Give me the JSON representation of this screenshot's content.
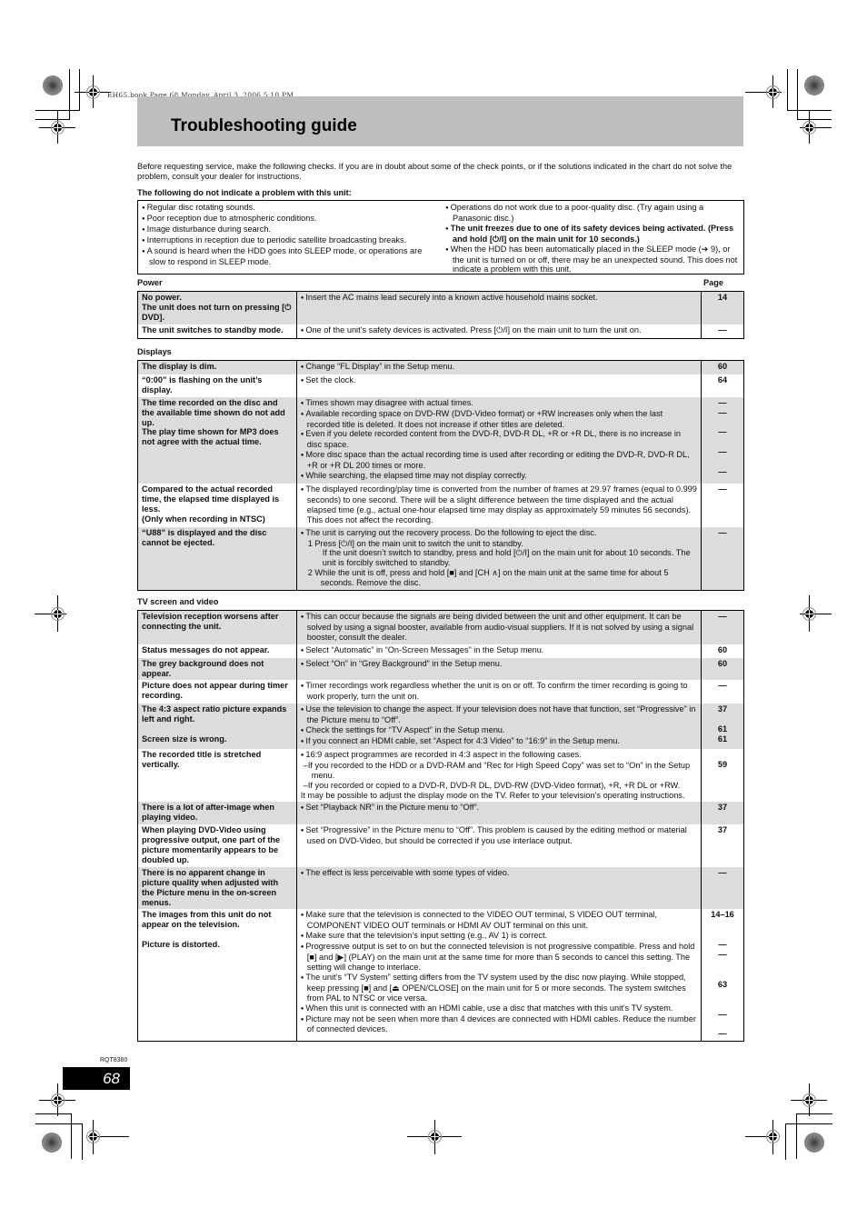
{
  "header": {
    "book_line": "EH65.book  Page 68  Monday, April 3, 2006  5:10 PM",
    "title": "Troubleshooting guide"
  },
  "intro": "Before requesting service, make the following checks. If you are in doubt about some of the check points, or if the solutions indicated in the chart do not solve the problem, consult your dealer for instructions.",
  "no_problem": {
    "heading": "The following do not indicate a problem with this unit:",
    "left": [
      {
        "text": "Regular disc rotating sounds.",
        "bold": false
      },
      {
        "text": "Poor reception due to atmospheric conditions.",
        "bold": false
      },
      {
        "text": "Image disturbance during search.",
        "bold": false
      },
      {
        "text": "Interruptions in reception due to periodic satellite broadcasting breaks.",
        "bold": false
      },
      {
        "text": "A sound is heard when the HDD goes into SLEEP mode, or operations are slow to respond in SLEEP mode.",
        "bold": false
      }
    ],
    "right": [
      {
        "text": "Operations do not work due to a poor-quality disc. (Try again using a Panasonic disc.)",
        "bold": false
      },
      {
        "text": "The unit freezes due to one of its safety devices being activated. (Press and hold [⏻/I] on the main unit for 10 seconds.)",
        "bold": true
      },
      {
        "text": "When the HDD has been automatically placed in the SLEEP mode (➔ 9), or the unit is turned on or off, there may be an unexpected sound. This does not indicate a problem with this unit.",
        "bold": false
      }
    ]
  },
  "page_column_label": "Page",
  "sections": {
    "power": {
      "heading": "Power",
      "rows": [
        {
          "problems": [
            "No power.",
            "The unit does not turn on pressing [⏻ DVD]."
          ],
          "solutions": [
            {
              "t": "b",
              "text": "Insert the AC mains lead securely into a known active household mains socket."
            }
          ],
          "pages": [
            "14"
          ],
          "shade": true
        },
        {
          "problems": [
            "The unit switches to standby mode."
          ],
          "solutions": [
            {
              "t": "b",
              "text": "One of the unit’s safety devices is activated. Press [⏻/I] on the main unit to turn the unit on."
            }
          ],
          "pages": [
            "—"
          ],
          "shade": false
        }
      ]
    },
    "displays": {
      "heading": "Displays",
      "rows": [
        {
          "problems": [
            "The display is dim."
          ],
          "solutions": [
            {
              "t": "b",
              "text": "Change “FL Display” in the Setup menu."
            }
          ],
          "pages": [
            "60"
          ],
          "shade": true
        },
        {
          "problems": [
            "“0:00” is flashing on the unit’s display."
          ],
          "solutions": [
            {
              "t": "b",
              "text": "Set the clock."
            }
          ],
          "pages": [
            "64"
          ],
          "shade": false
        },
        {
          "problems": [
            "The time recorded on the disc and the available time shown do not add up.",
            "The play time shown for MP3 does not agree with the actual time."
          ],
          "solutions": [
            {
              "t": "b",
              "text": "Times shown may disagree with actual times."
            },
            {
              "t": "b",
              "text": "Available recording space on DVD-RW (DVD-Video format) or +RW increases only when the last recorded title is deleted. It does not increase if other titles are deleted."
            },
            {
              "t": "b",
              "text": "Even if you delete recorded content from the DVD-R, DVD-R DL, +R or +R DL, there is no increase in disc space."
            },
            {
              "t": "b",
              "text": "More disc space than the actual recording time is used after recording or editing the DVD-R, DVD-R DL, +R or +R DL 200 times or more."
            },
            {
              "t": "b",
              "text": "While searching, the elapsed time may not display correctly."
            }
          ],
          "pages": [
            "—",
            "—",
            "",
            "—",
            "",
            "—",
            "",
            "—"
          ],
          "shade": true
        },
        {
          "problems": [
            "Compared to the actual recorded time, the elapsed time displayed is less.",
            "(Only when recording in NTSC)"
          ],
          "solutions": [
            {
              "t": "b",
              "text": "The displayed recording/play time is converted from the number of frames at 29.97 frames (equal to 0.999 seconds) to one second. There will be a slight difference between the time displayed and the actual elapsed time (e.g., actual one-hour elapsed time may display as approximately 59 minutes 56 seconds). This does not affect the recording."
            }
          ],
          "pages": [
            "—"
          ],
          "shade": false
        },
        {
          "problems": [
            "“U88” is displayed and the disc cannot be ejected."
          ],
          "solutions": [
            {
              "t": "b",
              "text": "The unit is carrying out the recovery process. Do the following to eject the disc."
            },
            {
              "t": "n",
              "text": "1  Press [⏻/I] on the main unit to switch the unit to standby."
            },
            {
              "t": "i",
              "text": "If the unit doesn’t switch to standby, press and hold [⏻/I] on the main unit for about 10 seconds. The unit is forcibly switched to standby."
            },
            {
              "t": "n",
              "text": "2  While the unit is off, press and hold [■] and [CH ∧] on the main unit at the same time for about 5 seconds. Remove the disc."
            }
          ],
          "pages": [
            "—"
          ],
          "shade": true
        }
      ]
    },
    "tv": {
      "heading": "TV screen and video",
      "rows": [
        {
          "problems": [
            "Television reception worsens after connecting the unit."
          ],
          "solutions": [
            {
              "t": "b",
              "text": "This can occur because the signals are being divided between the unit and other equipment. It can be solved by using a signal booster, available from audio-visual suppliers. If it is not solved by using a signal booster, consult the dealer."
            }
          ],
          "pages": [
            "—"
          ],
          "shade": true
        },
        {
          "problems": [
            "Status messages do not appear."
          ],
          "solutions": [
            {
              "t": "b",
              "text": "Select “Automatic” in “On-Screen Messages” in the Setup menu."
            }
          ],
          "pages": [
            "60"
          ],
          "shade": false
        },
        {
          "problems": [
            "The grey background does not appear."
          ],
          "solutions": [
            {
              "t": "b",
              "text": "Select “On” in “Grey Background” in the Setup menu."
            }
          ],
          "pages": [
            "60"
          ],
          "shade": true
        },
        {
          "problems": [
            "Picture does not appear during timer recording."
          ],
          "solutions": [
            {
              "t": "b",
              "text": "Timer recordings work regardless whether the unit is on or off. To confirm the timer recording is going to work properly, turn the unit on."
            }
          ],
          "pages": [
            "—"
          ],
          "shade": false
        },
        {
          "problems": [
            "The 4:3 aspect ratio picture expands left and right.",
            "",
            "Screen size is wrong."
          ],
          "solutions": [
            {
              "t": "b",
              "text": "Use the television to change the aspect. If your television does not have that function, set “Progressive” in the Picture menu to “Off”."
            },
            {
              "t": "b",
              "text": "Check the settings for “TV Aspect” in the Setup menu."
            },
            {
              "t": "b",
              "text": "If you connect an HDMI cable, set “Aspect for 4:3 Video” to “16:9” in the Setup menu."
            }
          ],
          "pages": [
            "37",
            "",
            "61",
            "61"
          ],
          "shade": true
        },
        {
          "problems": [
            "The recorded title is stretched vertically."
          ],
          "solutions": [
            {
              "t": "b",
              "text": "16:9 aspect programmes are recorded in 4:3 aspect in the following cases."
            },
            {
              "t": "d",
              "text": "–If you recorded to the HDD or a DVD-RAM and “Rec for High Speed Copy” was set to “On” in the Setup menu."
            },
            {
              "t": "d",
              "text": "–If you recorded or copied to a DVD-R, DVD-R DL, DVD-RW (DVD-Video format), +R, +R DL or +RW."
            },
            {
              "t": "p",
              "text": "It may be possible to adjust the display mode on the TV. Refer to your television’s operating instructions."
            }
          ],
          "pages": [
            "",
            "59"
          ],
          "shade": false
        },
        {
          "problems": [
            "There is a lot of after-image when playing video."
          ],
          "solutions": [
            {
              "t": "b",
              "text": "Set “Playback NR” in the Picture menu to “Off”."
            }
          ],
          "pages": [
            "37"
          ],
          "shade": true
        },
        {
          "problems": [
            "When playing DVD-Video using progressive output, one part of the picture momentarily appears to be doubled up."
          ],
          "solutions": [
            {
              "t": "b",
              "text": "Set “Progressive” in the Picture menu to “Off”. This problem is caused by the editing method or material used on DVD-Video, but should be corrected if you use interlace output."
            }
          ],
          "pages": [
            "37"
          ],
          "shade": false
        },
        {
          "problems": [
            "There is no apparent change in picture quality when adjusted with the Picture menu in the on-screen menus."
          ],
          "solutions": [
            {
              "t": "b",
              "text": "The effect is less perceivable with some types of video."
            }
          ],
          "pages": [
            "—"
          ],
          "shade": true
        },
        {
          "problems": [
            "The images from this unit do not appear on the television.",
            "",
            "Picture is distorted."
          ],
          "solutions": [
            {
              "t": "b",
              "text": "Make sure that the television is connected to the VIDEO OUT terminal, S VIDEO OUT terminal, COMPONENT VIDEO OUT terminals or HDMI AV OUT terminal on this unit."
            },
            {
              "t": "b",
              "text": "Make sure that the television’s input setting (e.g., AV 1) is correct."
            },
            {
              "t": "b",
              "text": "Progressive output is set to on but the connected television is not progressive compatible. Press and hold [■] and [▶] (PLAY) on the main unit at the same time for more than 5 seconds to cancel this setting. The setting will change to interlace."
            },
            {
              "t": "b",
              "text": "The unit’s “TV System” setting differs from the TV system used by the disc now playing. While stopped, keep pressing [■] and [⏏ OPEN/CLOSE] on the main unit for 5 or more seconds. The system switches from PAL to NTSC or vice versa."
            },
            {
              "t": "b",
              "text": "When this unit is connected with an HDMI cable, use a disc that matches with this unit’s TV system."
            },
            {
              "t": "b",
              "text": "Picture may not be seen when more than 4 devices are connected with HDMI cables. Reduce the number of connected devices."
            }
          ],
          "pages": [
            "14–16",
            "",
            "",
            "—",
            "—",
            "",
            "",
            "63",
            "",
            "",
            "—",
            "",
            "—"
          ],
          "shade": false
        }
      ]
    }
  },
  "footer": {
    "doc_code": "RQT8380",
    "page_number": "68"
  }
}
